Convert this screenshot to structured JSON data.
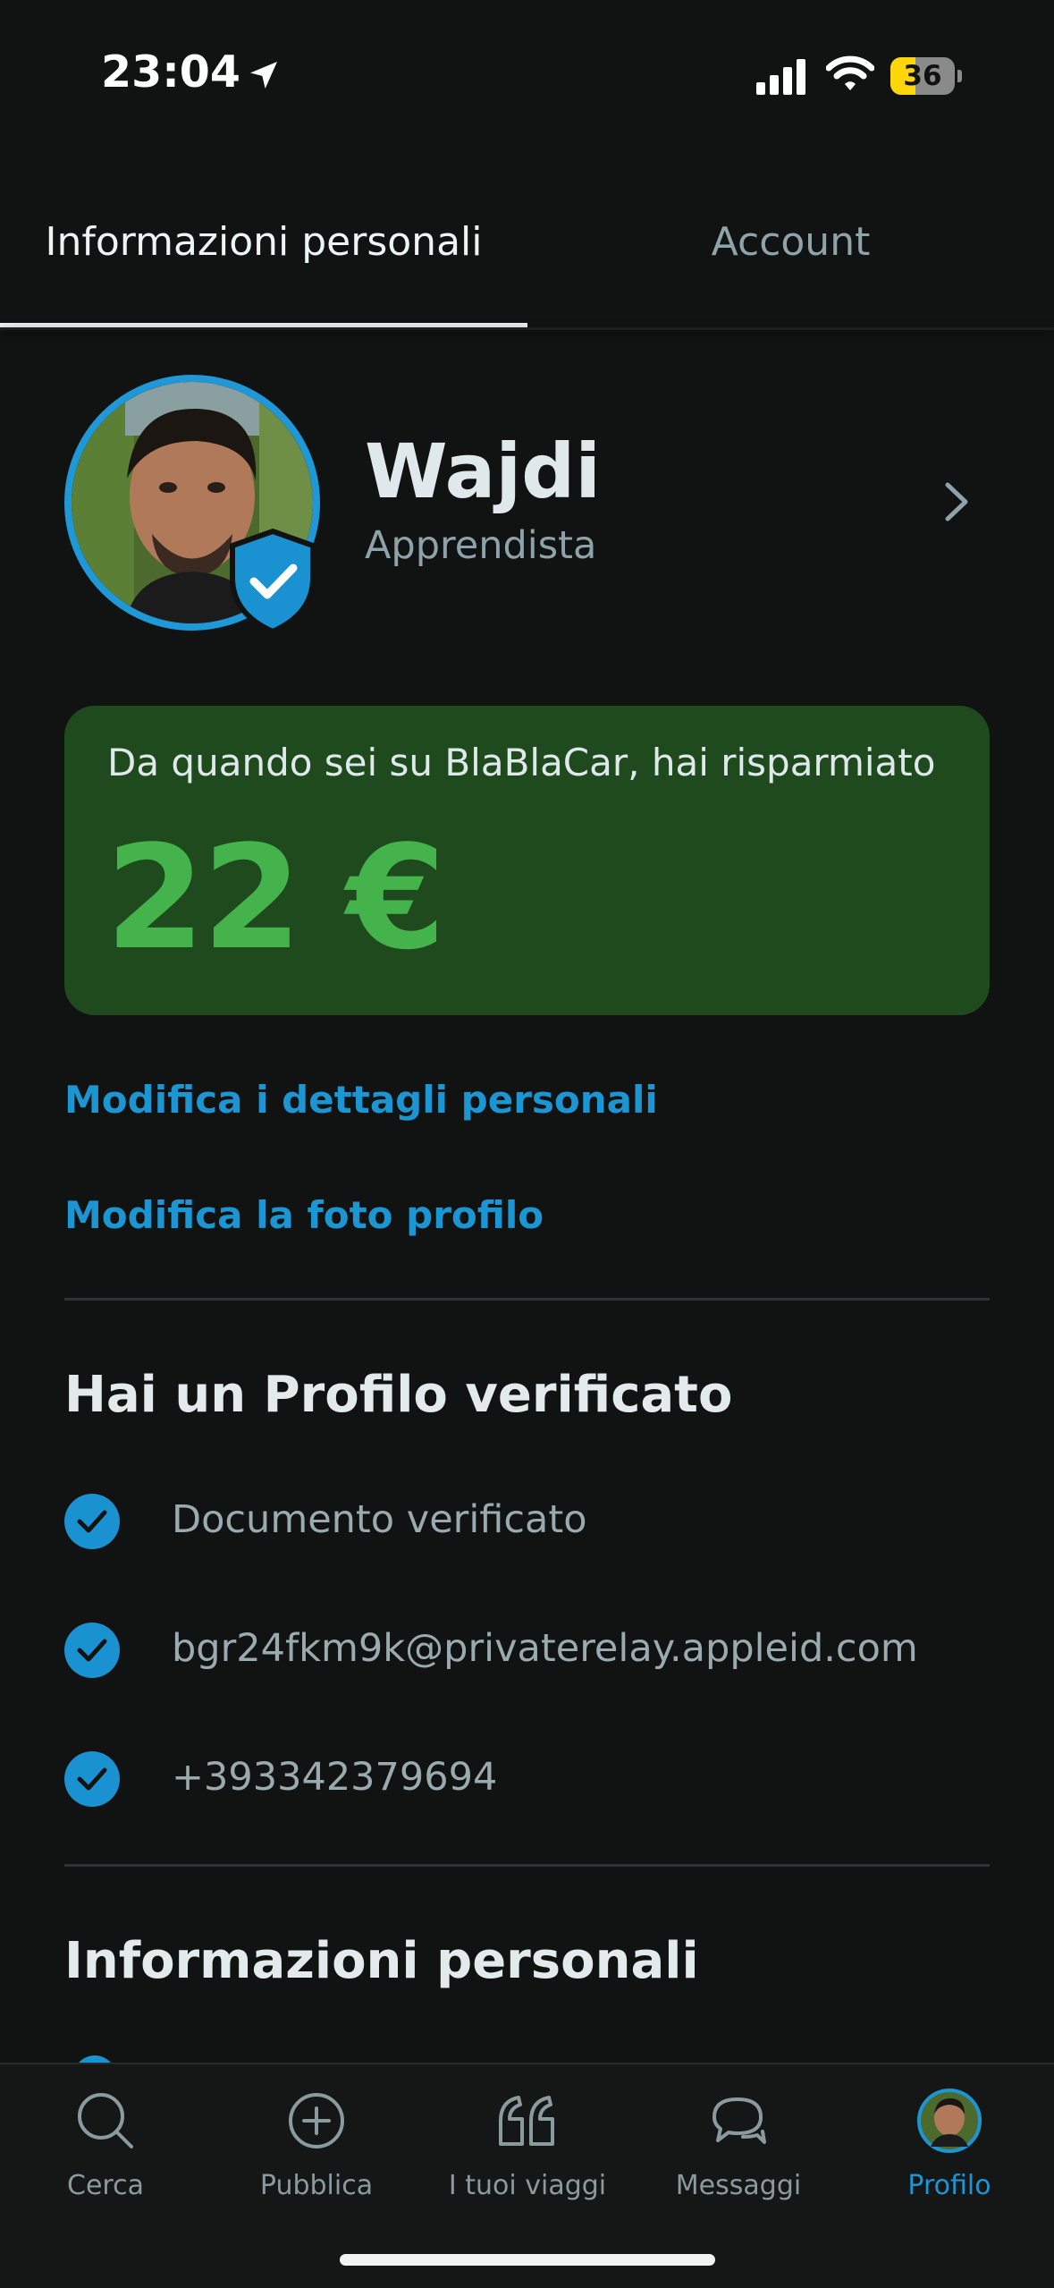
{
  "status_bar": {
    "time": "23:04",
    "battery": "36"
  },
  "tabs": [
    {
      "label": "Informazioni personali",
      "active": true
    },
    {
      "label": "Account",
      "active": false
    }
  ],
  "profile": {
    "name": "Wajdi",
    "level": "Apprendista"
  },
  "savings": {
    "text": "Da quando sei su BlaBlaCar, hai risparmiato",
    "amount": "22 €"
  },
  "links": {
    "edit_details": "Modifica i dettagli personali",
    "edit_photo": "Modifica la foto profilo"
  },
  "verified_section": {
    "title": "Hai un Profilo verificato",
    "items": [
      "Documento verificato",
      "bgr24fkm9k@privaterelay.appleid.com",
      "+393342379694"
    ]
  },
  "personal_info_section": {
    "title": "Informazioni personali"
  },
  "bottom_nav": [
    {
      "label": "Cerca",
      "icon": "search-icon"
    },
    {
      "label": "Pubblica",
      "icon": "plus-circle-icon"
    },
    {
      "label": "I tuoi viaggi",
      "icon": "quote-icon"
    },
    {
      "label": "Messaggi",
      "icon": "chat-bubbles-icon"
    },
    {
      "label": "Profilo",
      "icon": "avatar-icon",
      "active": true
    }
  ],
  "colors": {
    "accent": "#1c95d3",
    "savings_bg": "#1f4a1e",
    "savings_amount": "#45b34c",
    "background": "#111212"
  }
}
